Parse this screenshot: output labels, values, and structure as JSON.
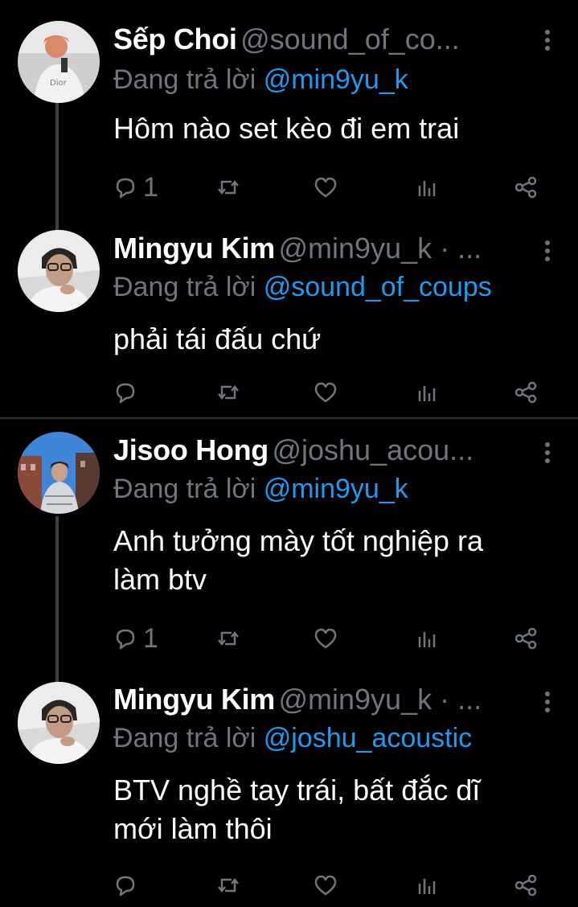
{
  "tweets": [
    {
      "name": "Sếp Choi",
      "handle": "@sound_of_co...",
      "reply_prefix": "Đang trả lời",
      "reply_to": "@min9yu_k",
      "text_lines": [
        "Hôm nào set kèo đi em trai"
      ],
      "reply_count": "1"
    },
    {
      "name": "Mingyu Kim",
      "handle": "@min9yu_k · ...",
      "reply_prefix": "Đang trả lời",
      "reply_to": "@sound_of_coups",
      "text_lines": [
        "phải tái đấu chứ"
      ],
      "reply_count": ""
    },
    {
      "name": "Jisoo Hong",
      "handle": "@joshu_acou...",
      "reply_prefix": "Đang trả lời",
      "reply_to": "@min9yu_k",
      "text_lines": [
        "Anh tưởng mày tốt nghiệp ra",
        "làm btv"
      ],
      "reply_count": "1"
    },
    {
      "name": "Mingyu Kim",
      "handle": "@min9yu_k · ...",
      "reply_prefix": "Đang trả lời",
      "reply_to": "@joshu_acoustic",
      "text_lines": [
        "BTV nghề tay trái, bất đắc dĩ",
        "mới làm thôi"
      ],
      "reply_count": ""
    }
  ],
  "icons": {
    "reply": "reply-icon",
    "retweet": "retweet-icon",
    "like": "heart-icon",
    "views": "analytics-icon",
    "share": "share-icon",
    "more": "more-vertical-icon"
  },
  "colors": {
    "background": "#000000",
    "name": "#ffffff",
    "secondary": "#6e767d",
    "mention": "#1d9bf0",
    "divider": "#2f3336"
  }
}
